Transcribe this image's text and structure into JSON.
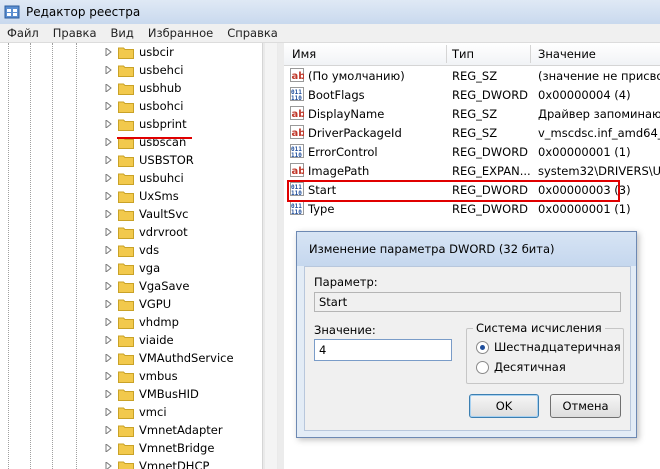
{
  "window": {
    "title": "Редактор реестра"
  },
  "menu": [
    "Файл",
    "Правка",
    "Вид",
    "Избранное",
    "Справка"
  ],
  "tree": {
    "items": [
      "usbcir",
      "usbehci",
      "usbhub",
      "usbohci",
      "usbprint",
      "usbscan",
      "USBSTOR",
      "usbuhci",
      "UxSms",
      "VaultSvc",
      "vdrvroot",
      "vds",
      "vga",
      "VgaSave",
      "VGPU",
      "vhdmp",
      "viaide",
      "VMAuthdService",
      "vmbus",
      "VMBusHID",
      "vmci",
      "VmnetAdapter",
      "VmnetBridge",
      "VmnetDHCP"
    ],
    "highlighted_index": 6
  },
  "list": {
    "columns": {
      "name": "Имя",
      "type": "Тип",
      "value": "Значение"
    },
    "rows": [
      {
        "icon": "string",
        "name": "(По умолчанию)",
        "type": "REG_SZ",
        "value": "(значение не присвоено)"
      },
      {
        "icon": "dword",
        "name": "BootFlags",
        "type": "REG_DWORD",
        "value": "0x00000004 (4)"
      },
      {
        "icon": "string",
        "name": "DisplayName",
        "type": "REG_SZ",
        "value": "Драйвер запоминающ"
      },
      {
        "icon": "string",
        "name": "DriverPackageId",
        "type": "REG_SZ",
        "value": "v_mscdsc.inf_amd64_n"
      },
      {
        "icon": "dword",
        "name": "ErrorControl",
        "type": "REG_DWORD",
        "value": "0x00000001 (1)"
      },
      {
        "icon": "string",
        "name": "ImagePath",
        "type": "REG_EXPAN...",
        "value": "system32\\DRIVERS\\USBS"
      },
      {
        "icon": "dword",
        "name": "Start",
        "type": "REG_DWORD",
        "value": "0x00000003 (3)"
      },
      {
        "icon": "dword",
        "name": "Type",
        "type": "REG_DWORD",
        "value": "0x00000001 (1)"
      }
    ]
  },
  "dialog": {
    "title": "Изменение параметра DWORD (32 бита)",
    "param_label": "Параметр:",
    "param_value": "Start",
    "value_label": "Значение:",
    "value": "4",
    "base_group": "Система исчисления",
    "hex_label": "Шестнадцатеричная",
    "dec_label": "Десятичная",
    "selected_base": "hex",
    "ok": "OK",
    "cancel": "Отмена"
  },
  "colors": {
    "highlight": "#e00000",
    "folder": "#f2c94c",
    "dword_icon": "#1f4e9c",
    "string_icon": "#c0392b"
  }
}
